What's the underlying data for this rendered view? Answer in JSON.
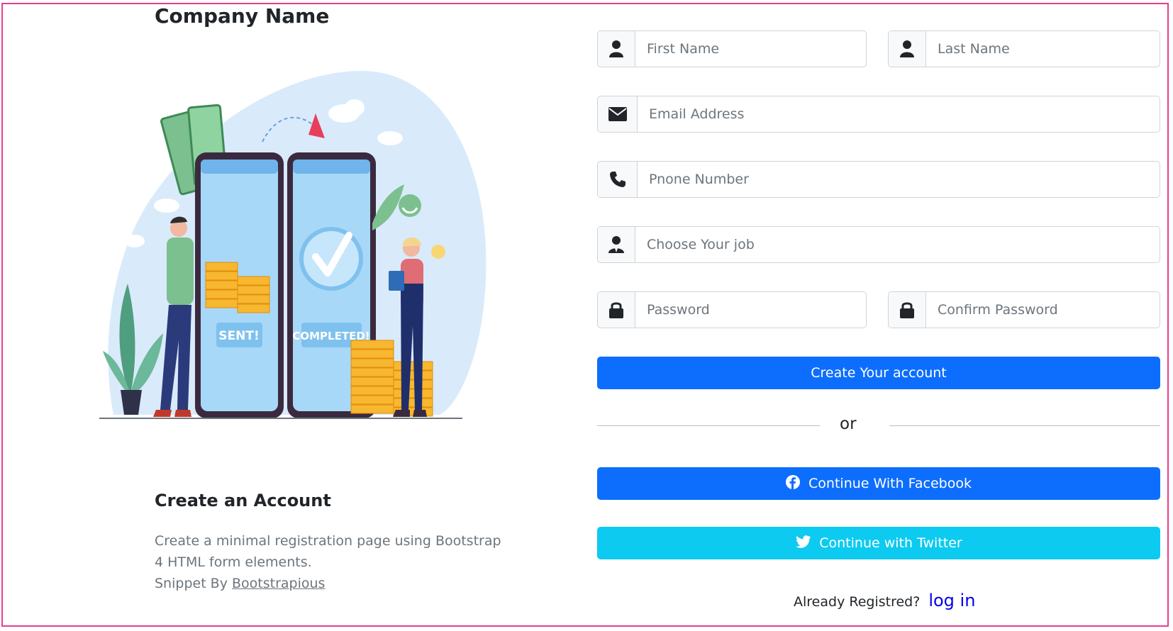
{
  "brand": {
    "name": "Company Name"
  },
  "intro": {
    "heading": "Create an Account",
    "description": "Create a minimal registration page using Bootstrap 4 HTML form elements.",
    "credit_prefix": "Snippet By",
    "credit_link": "Bootstrapious"
  },
  "illustration": {
    "sent_label": "SENT!",
    "completed_label": "COMPLETED!"
  },
  "form": {
    "first_name": {
      "placeholder": "First Name",
      "icon": "user-icon"
    },
    "last_name": {
      "placeholder": "Last Name",
      "icon": "user-icon"
    },
    "email": {
      "placeholder": "Email Address",
      "icon": "envelope-icon"
    },
    "phone": {
      "placeholder": "Pnone Number",
      "icon": "phone-icon"
    },
    "job": {
      "placeholder": "Choose Your job",
      "icon": "user-tie-icon"
    },
    "password": {
      "placeholder": "Password",
      "icon": "lock-icon"
    },
    "confirm_password": {
      "placeholder": "Confirm Password",
      "icon": "lock-icon"
    },
    "submit_label": "Create Your account",
    "divider_text": "or",
    "facebook_label": "Continue With Facebook",
    "twitter_label": "Continue with Twitter",
    "already_registered": "Already Registred?",
    "login_link": "log in"
  },
  "colors": {
    "primary": "#0d6efd",
    "info": "#0dcaf0",
    "frame_border": "#e83e8c",
    "link": "#0000ee"
  }
}
